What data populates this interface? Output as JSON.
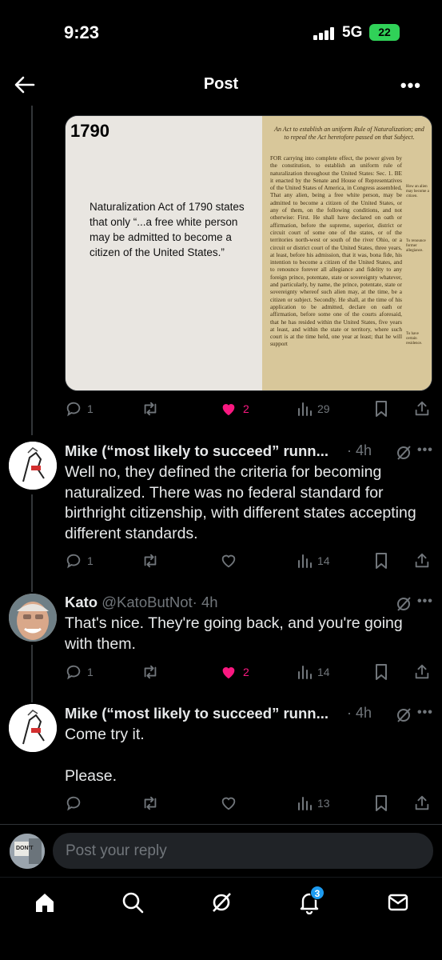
{
  "status_bar": {
    "time": "9:23",
    "network": "5G",
    "battery": "22"
  },
  "header": {
    "title": "Post",
    "back_icon": "arrow-left-icon",
    "more_icon": "ellipsis-icon"
  },
  "image_card": {
    "year": "1790",
    "quote": "Naturalization Act of 1790 states that only “...a free white person may be admitted to become a citizen of the United States.”",
    "doc_heading": "An Act to establish an uniform Rule of Naturalization; and to repeal the Act heretofore passed on that Subject.",
    "doc_text": "FOR carrying into complete effect, the power given by the constitution, to establish an uniform rule of naturalization throughout the United States: Sec. 1. BE it enacted by the Senate and House of Representatives of the United States of America, in Congress assembled, That any alien, being a free white person, may be admitted to become a citizen of the United States, or any of them, on the following conditions, and not otherwise: First. He shall have declared on oath or affirmation, before the supreme, superior, district or circuit court of some one of the states, or of the territories north-west or south of the river Ohio, or a circuit or district court of the United States, three years, at least, before his admission, that it was, bona fide, his intention to become a citizen of the United States, and to renounce forever all allegiance and fidelity to any foreign prince, potentate, state or sovereignty whatever, and particularly, by name, the prince, potentate, state or sovereignty whereof such alien may, at the time, be a citizen or subject. Secondly. He shall, at the time of his application to be admitted, declare on oath or affirmation, before some one of the courts aforesaid, that he has resided within the United States, five years at least, and within the state or territory, where such court is at the time held, one year at least; that he will support",
    "margin_notes": [
      "How an alien may become a citizen.",
      "To renounce former allegiance.",
      "To have certain residence."
    ]
  },
  "main_actions": {
    "replies": "1",
    "reposts": "",
    "likes": "2",
    "views": "29"
  },
  "replies": [
    {
      "name": "Mike (“most likely to succeed” runn...",
      "handle": "",
      "time": "· 4h",
      "text": "Well no, they defined the criteria for becoming naturalized. There was no federal standard for birthright citizenship, with different states accepting different standards.",
      "stats": {
        "replies": "1",
        "reposts": "",
        "likes": "",
        "views": "14"
      }
    },
    {
      "name": "Kato",
      "handle": "@KatoButNot",
      "time": "· 4h",
      "text": "That's nice. They're going back, and you're going with them.",
      "stats": {
        "replies": "1",
        "reposts": "",
        "likes": "2",
        "views": "14"
      }
    },
    {
      "name": "Mike (“most likely to succeed” runn...",
      "handle": "",
      "time": "· 4h",
      "text_line1": "Come try it.",
      "text_line2": "Please.",
      "stats": {
        "replies": "",
        "reposts": "",
        "likes": "",
        "views": "13"
      }
    }
  ],
  "reply_box": {
    "placeholder": "Post your reply",
    "avatar_text": "DON'T"
  },
  "tab_bar": {
    "items": [
      "home-icon",
      "search-icon",
      "grok-icon",
      "notifications-icon",
      "messages-icon"
    ],
    "notification_badge": "3"
  },
  "colors": {
    "background": "#000000",
    "text": "#e7e9ea",
    "muted": "#71767b",
    "like": "#f91880",
    "accent": "#1d9bf0"
  }
}
